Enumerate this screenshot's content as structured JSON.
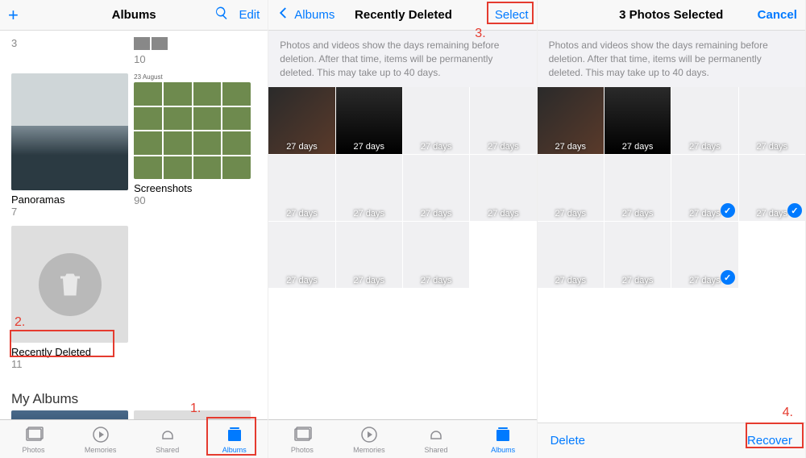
{
  "screen1": {
    "title": "Albums",
    "edit": "Edit",
    "topCounts": [
      "3",
      "10"
    ],
    "albums": [
      {
        "name": "Panoramas",
        "count": "7"
      },
      {
        "name": "Screenshots",
        "count": "90",
        "date": "23 August"
      },
      {
        "name": "Recently Deleted",
        "count": "11"
      }
    ],
    "section": "My Albums"
  },
  "screen2": {
    "back": "Albums",
    "title": "Recently Deleted",
    "select": "Select",
    "info": "Photos and videos show the days remaining before deletion. After that time, items will be permanently deleted. This may take up to 40 days.",
    "days": "27 days"
  },
  "screen3": {
    "title": "3 Photos Selected",
    "cancel": "Cancel",
    "info": "Photos and videos show the days remaining before deletion. After that time, items will be permanently deleted. This may take up to 40 days.",
    "days": "27 days",
    "delete": "Delete",
    "recover": "Recover"
  },
  "tabs": {
    "photos": "Photos",
    "memories": "Memories",
    "shared": "Shared",
    "albums": "Albums"
  },
  "callouts": {
    "c1": "1.",
    "c2": "2.",
    "c3": "3.",
    "c4": "4."
  }
}
